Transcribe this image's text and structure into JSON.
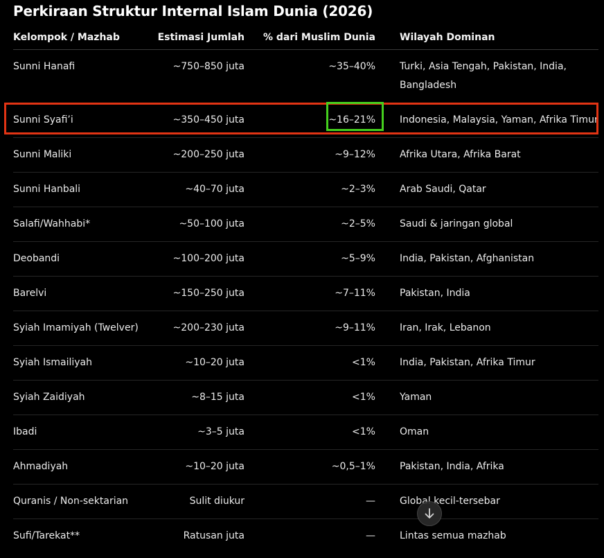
{
  "title": "Perkiraan Struktur Internal Islam Dunia (2026)",
  "table": {
    "headers": [
      "Kelompok / Mazhab",
      "Estimasi Jumlah",
      "% dari Muslim Dunia",
      "Wilayah Dominan"
    ],
    "rows": [
      [
        "Sunni Hanafi",
        "~750–850 juta",
        "~35–40%",
        "Turki, Asia Tengah, Pakistan, India, Bangladesh"
      ],
      [
        "Sunni Syafi’i",
        "~350–450 juta",
        "~16–21%",
        "Indonesia, Malaysia, Yaman, Afrika Timur"
      ],
      [
        "Sunni Maliki",
        "~200–250 juta",
        "~9–12%",
        "Afrika Utara, Afrika Barat"
      ],
      [
        "Sunni Hanbali",
        "~40–70 juta",
        "~2–3%",
        "Arab Saudi, Qatar"
      ],
      [
        "Salafi/Wahhabi*",
        "~50–100 juta",
        "~2–5%",
        "Saudi & jaringan global"
      ],
      [
        "Deobandi",
        "~100–200 juta",
        "~5–9%",
        "India, Pakistan, Afghanistan"
      ],
      [
        "Barelvi",
        "~150–250 juta",
        "~7–11%",
        "Pakistan, India"
      ],
      [
        "Syiah Imamiyah (Twelver)",
        "~200–230 juta",
        "~9–11%",
        "Iran, Irak, Lebanon"
      ],
      [
        "Syiah Ismailiyah",
        "~10–20 juta",
        "<1%",
        "India, Pakistan, Afrika Timur"
      ],
      [
        "Syiah Zaidiyah",
        "~8–15 juta",
        "<1%",
        "Yaman"
      ],
      [
        "Ibadi",
        "~3–5 juta",
        "<1%",
        "Oman"
      ],
      [
        "Ahmadiyah",
        "~10–20 juta",
        "~0,5–1%",
        "Pakistan, India, Afrika"
      ],
      [
        "Quranis / Non-sektarian",
        "Sulit diukur",
        "—",
        "Global kecil-tersebar"
      ],
      [
        "Sufi/Tarekat**",
        "Ratusan juta",
        "—",
        "Lintas semua mazhab"
      ]
    ]
  },
  "highlight": {
    "row_color": "#e23414",
    "cell_color": "#45d01e"
  },
  "scroll_button": {
    "icon": "arrow-down-icon"
  }
}
